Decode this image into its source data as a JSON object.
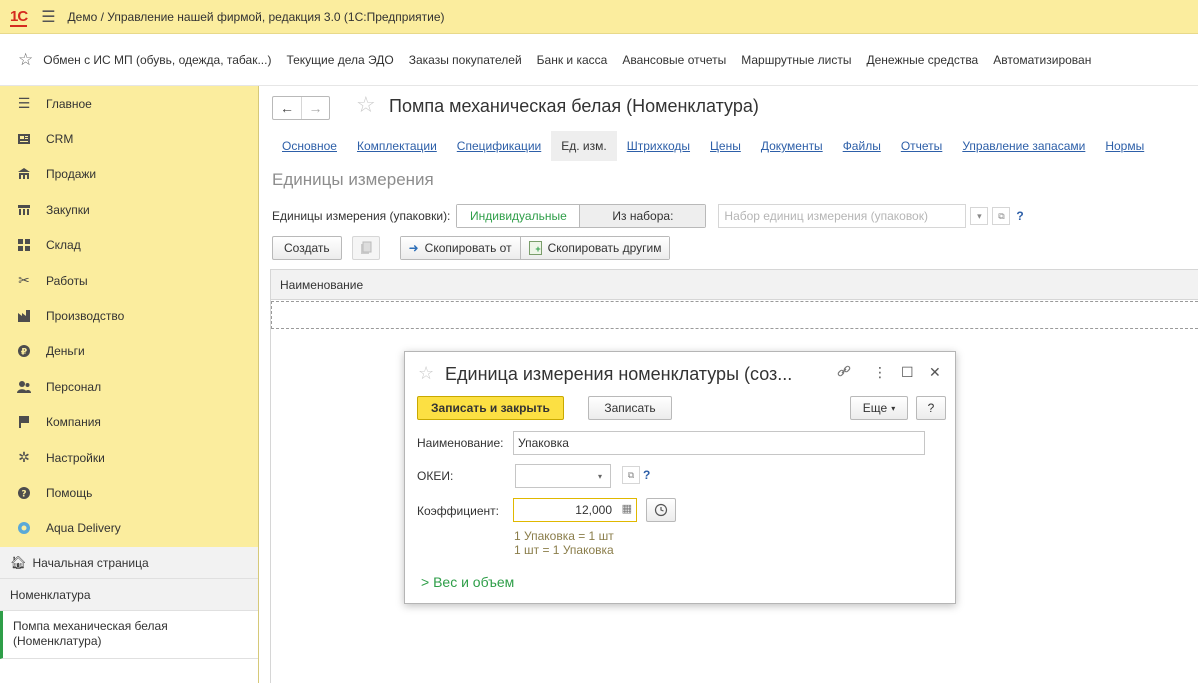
{
  "titlebar": {
    "logo": "1С",
    "title": "Демо / Управление нашей фирмой, редакция 3.0  (1С:Предприятие)"
  },
  "favorites": [
    "Обмен с ИС МП (обувь, одежда, табак...)",
    "Текущие дела ЭДО",
    "Заказы покупателей",
    "Банк и касса",
    "Авансовые отчеты",
    "Маршрутные листы",
    "Денежные средства",
    "Автоматизирован"
  ],
  "sidebar": {
    "items": [
      {
        "label": "Главное",
        "icon": "menu-icon"
      },
      {
        "label": "CRM",
        "icon": "crm-icon"
      },
      {
        "label": "Продажи",
        "icon": "shop-icon"
      },
      {
        "label": "Закупки",
        "icon": "purchases-icon"
      },
      {
        "label": "Склад",
        "icon": "warehouse-icon"
      },
      {
        "label": "Работы",
        "icon": "works-icon"
      },
      {
        "label": "Производство",
        "icon": "factory-icon"
      },
      {
        "label": "Деньги",
        "icon": "money-icon"
      },
      {
        "label": "Персонал",
        "icon": "staff-icon"
      },
      {
        "label": "Компания",
        "icon": "flag-icon"
      },
      {
        "label": "Настройки",
        "icon": "gear-icon"
      },
      {
        "label": "Помощь",
        "icon": "help-icon"
      },
      {
        "label": "Aqua Delivery",
        "icon": "location-icon"
      }
    ],
    "home": "Начальная страница",
    "open_list": "Номенклатура",
    "active_doc": "Помпа механическая белая (Номенклатура)"
  },
  "main": {
    "title": "Помпа механическая белая (Номенклатура)",
    "tabs": [
      {
        "label": "Основное",
        "active": false
      },
      {
        "label": "Комплектации",
        "active": false
      },
      {
        "label": "Спецификации",
        "active": false
      },
      {
        "label": "Ед. изм.",
        "active": true
      },
      {
        "label": "Штрихкоды",
        "active": false
      },
      {
        "label": "Цены",
        "active": false
      },
      {
        "label": "Документы",
        "active": false
      },
      {
        "label": "Файлы",
        "active": false
      },
      {
        "label": "Отчеты",
        "active": false
      },
      {
        "label": "Управление запасами",
        "active": false
      },
      {
        "label": "Нормы",
        "active": false
      }
    ],
    "section_title": "Единицы измерения",
    "units_label": "Единицы измерения (упаковки):",
    "opt_individual": "Индивидуальные",
    "opt_from_set": "Из набора:",
    "set_placeholder": "Набор единиц измерения (упаковок)",
    "help": "?",
    "create_btn": "Создать",
    "copy_from_btn": "Скопировать от",
    "copy_to_btn": "Скопировать другим",
    "col_name": "Наименование"
  },
  "dialog": {
    "title": "Единица измерения номенклатуры (соз...",
    "save_close": "Записать и закрыть",
    "save": "Записать",
    "more": "Еще",
    "help": "?",
    "name_label": "Наименование:",
    "name_value": "Упаковка",
    "okei_label": "ОКЕИ:",
    "okei_value": "",
    "coef_label": "Коэффициент:",
    "coef_value": "12,000",
    "hint1": "1 Упаковка = 1 шт",
    "hint2": "1 шт = 1 Упаковка",
    "weight_link": "Вес и объем"
  },
  "colors": {
    "accent_yellow": "#fbed9e",
    "link_blue": "#2d5fa8",
    "green": "#2e9e48",
    "primary_button": "#fce043"
  }
}
